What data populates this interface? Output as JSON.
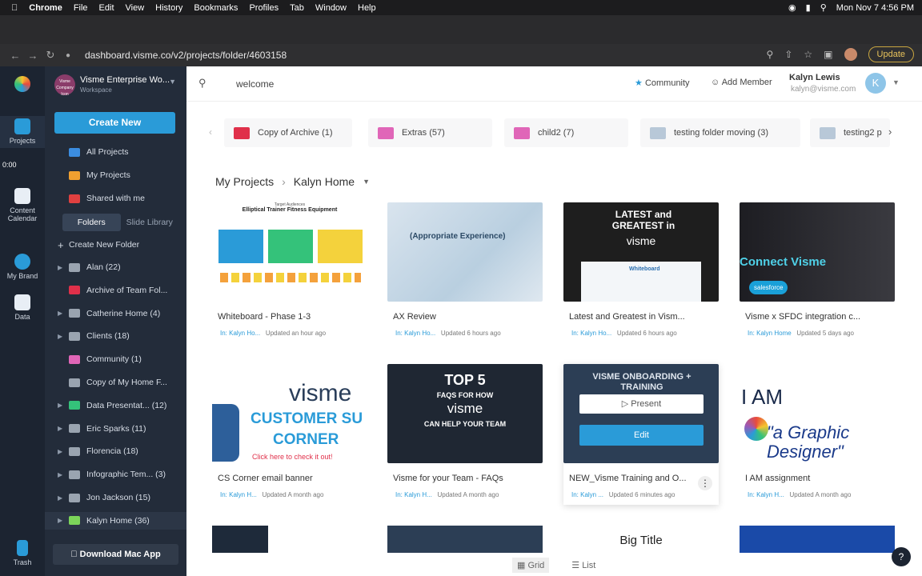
{
  "menubar": {
    "app": "Chrome",
    "items": [
      "File",
      "Edit",
      "View",
      "History",
      "Bookmarks",
      "Profiles",
      "Tab",
      "Window",
      "Help"
    ],
    "clock": "Mon Nov 7  4:56 PM"
  },
  "browser": {
    "url": "dashboard.visme.co/v2/projects/folder/4603158",
    "update_label": "Update"
  },
  "rail": {
    "projects": "Projects",
    "timer": "0:00",
    "content_calendar": "Content Calendar",
    "my_brand": "My Brand",
    "data": "Data",
    "trash": "Trash"
  },
  "workspace": {
    "logo_text": "Visme Company Icon",
    "name": "Visme Enterprise Wo...",
    "sub": "Workspace"
  },
  "sidebar": {
    "create_label": "Create New",
    "nav": [
      {
        "label": "All Projects",
        "color": "#3b8de0"
      },
      {
        "label": "My Projects",
        "color": "#f0a030"
      },
      {
        "label": "Shared with me",
        "color": "#e04040"
      }
    ],
    "tab_folders": "Folders",
    "tab_slide": "Slide Library",
    "new_folder": "Create New Folder",
    "folders": [
      {
        "label": "Alan (22)",
        "color": "#9aa4b0",
        "arrow": "▶"
      },
      {
        "label": "Archive of Team Fol...",
        "color": "#e0304a",
        "arrow": ""
      },
      {
        "label": "Catherine Home (4)",
        "color": "#9aa4b0",
        "arrow": "▶"
      },
      {
        "label": "Clients (18)",
        "color": "#9aa4b0",
        "arrow": "▶"
      },
      {
        "label": "Community (1)",
        "color": "#e066b8",
        "arrow": ""
      },
      {
        "label": "Copy of My Home F...",
        "color": "#9aa4b0",
        "arrow": ""
      },
      {
        "label": "Data Presentat... (12)",
        "color": "#34c27a",
        "arrow": "▶"
      },
      {
        "label": "Eric Sparks (11)",
        "color": "#9aa4b0",
        "arrow": "▶"
      },
      {
        "label": "Florencia (18)",
        "color": "#9aa4b0",
        "arrow": "▶"
      },
      {
        "label": "Infographic Tem...  (3)",
        "color": "#9aa4b0",
        "arrow": "▶"
      },
      {
        "label": "Jon Jackson (15)",
        "color": "#9aa4b0",
        "arrow": "▶"
      },
      {
        "label": "Kalyn Home (36)",
        "color": "#7cd55a",
        "arrow": "▶"
      }
    ],
    "download": "Download Mac App"
  },
  "topbar": {
    "search_value": "welcome",
    "community": "Community",
    "add_member": "Add Member",
    "user_name": "Kalyn Lewis",
    "user_email": "kalyn@visme.com",
    "avatar": "K"
  },
  "folder_strip": [
    {
      "label": "Copy of Archive (1)",
      "color": "#e0304a"
    },
    {
      "label": "Extras (57)",
      "color": "#e066b8"
    },
    {
      "label": "child2 (7)",
      "color": "#e066b8"
    },
    {
      "label": "testing folder moving (3)",
      "color": "#b8c8d8"
    },
    {
      "label": "testing2 p",
      "color": "#b8c8d8"
    }
  ],
  "breadcrumb": {
    "root": "My Projects",
    "current": "Kalyn Home"
  },
  "cards": [
    {
      "title": "Whiteboard - Phase 1-3",
      "in": "In: Kalyn Ho...",
      "updated": "Updated an hour ago",
      "thumb_text": "Elliptical Trainer Fitness Equipment",
      "thumb_sub": "Target Audiences"
    },
    {
      "title": "AX Review",
      "in": "In: Kalyn Ho...",
      "updated": "Updated 6 hours ago",
      "thumb_text": "(Appropriate Experience)"
    },
    {
      "title": "Latest and Greatest in Vism...",
      "in": "In: Kalyn Ho...",
      "updated": "Updated 6 hours ago",
      "thumb_text": "LATEST and GREATEST in",
      "thumb_sub": "visme",
      "thumb_extra": "Whiteboard"
    },
    {
      "title": "Visme x SFDC integration c...",
      "in": "In: Kalyn Home",
      "updated": "Updated 5 days ago",
      "thumb_text": "Connect Visme",
      "thumb_sub": "salesforce"
    },
    {
      "title": "CS Corner email banner",
      "in": "In: Kalyn H...",
      "updated": "Updated A month ago",
      "thumb_text": "visme",
      "thumb_sub": "CUSTOMER SU",
      "thumb_extra": "CORNER",
      "thumb_link": "Click here to check it out!"
    },
    {
      "title": "Visme for your Team - FAQs",
      "in": "In: Kalyn H...",
      "updated": "Updated A month ago",
      "thumb_text": "TOP 5",
      "thumb_sub": "FAQS FOR HOW",
      "thumb_extra": "visme",
      "thumb_cap": "CAN HELP YOUR TEAM"
    },
    {
      "title": "NEW_Visme Training and O...",
      "in": "In: Kalyn ...",
      "updated": "Updated 6 minutes ago",
      "thumb_text": "VISME ONBOARDING + TRAINING",
      "present": "Present",
      "edit": "Edit"
    },
    {
      "title": "I AM assignment",
      "in": "In: Kalyn H...",
      "updated": "Updated A month ago",
      "thumb_text": "I AM",
      "thumb_sub": "\"a Graphic Designer\""
    }
  ],
  "row3": {
    "big_title": "Big Title"
  },
  "view": {
    "grid": "Grid",
    "list": "List"
  },
  "help": "?"
}
